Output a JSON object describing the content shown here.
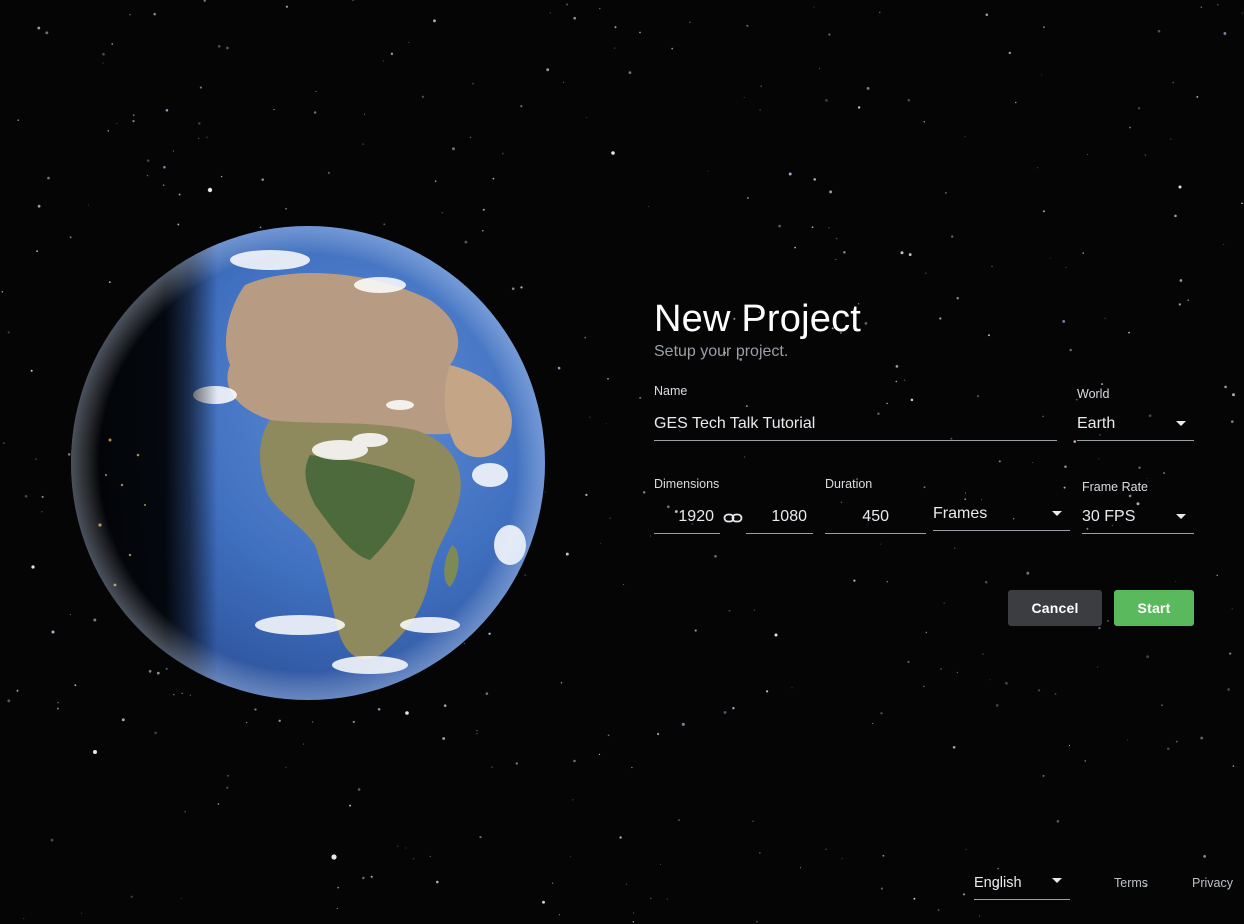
{
  "dialog": {
    "title": "New Project",
    "subtitle": "Setup your project.",
    "name": {
      "label": "Name",
      "value": "GES Tech Talk Tutorial"
    },
    "world": {
      "label": "World",
      "value": "Earth"
    },
    "dimensions": {
      "label": "Dimensions",
      "width": "1920",
      "height": "1080"
    },
    "duration": {
      "label": "Duration",
      "value": "450",
      "unit": "Frames"
    },
    "frame_rate": {
      "label": "Frame Rate",
      "value": "30 FPS"
    },
    "cancel_label": "Cancel",
    "start_label": "Start"
  },
  "footer": {
    "language": "English",
    "terms": "Terms",
    "privacy": "Privacy"
  },
  "colors": {
    "start_button": "#5bb95d",
    "cancel_button": "#3c3d40",
    "background": "#050506"
  },
  "icons": {
    "link": "link-icon",
    "dropdown": "caret-down-icon"
  }
}
